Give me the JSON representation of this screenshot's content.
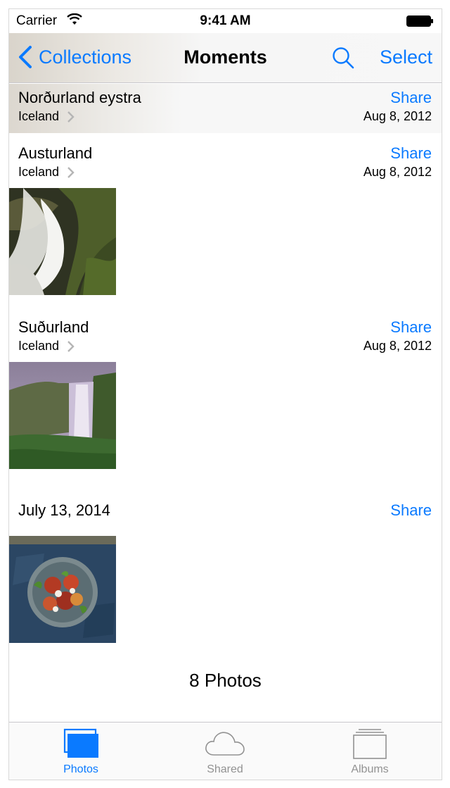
{
  "status_bar": {
    "carrier": "Carrier",
    "time": "9:41 AM"
  },
  "nav": {
    "back_label": "Collections",
    "title": "Moments",
    "select_label": "Select"
  },
  "sections": [
    {
      "title": "Norðurland eystra",
      "subtitle": "Iceland",
      "date": "Aug 8, 2012",
      "share": "Share"
    },
    {
      "title": "Austurland",
      "subtitle": "Iceland",
      "date": "Aug 8, 2012",
      "share": "Share",
      "photo": "waterfall-mossy-rocks"
    },
    {
      "title": "Suðurland",
      "subtitle": "Iceland",
      "date": "Aug 8, 2012",
      "share": "Share",
      "photo": "waterfall-green-cliffs"
    },
    {
      "title": "July 13, 2014",
      "share": "Share",
      "photo": "salad-plate"
    }
  ],
  "footer": {
    "photo_count": "8 Photos"
  },
  "tabs": [
    {
      "label": "Photos",
      "icon": "photos-icon",
      "active": true
    },
    {
      "label": "Shared",
      "icon": "cloud-icon",
      "active": false
    },
    {
      "label": "Albums",
      "icon": "albums-icon",
      "active": false
    }
  ],
  "colors": {
    "accent": "#0a7aff",
    "inactive": "#929292"
  }
}
